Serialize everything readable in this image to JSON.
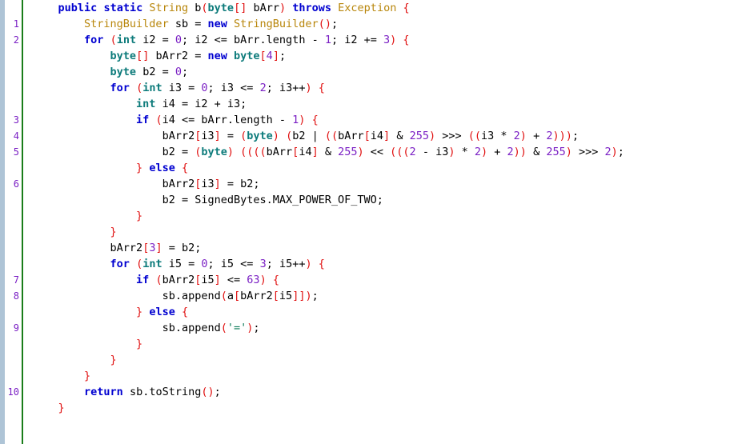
{
  "editor": {
    "name": "code-viewer",
    "language": "java",
    "background_color": "#ffffff",
    "edge_strip_color": "#aec4d6",
    "separator_color": "#1a7d1a",
    "line_number_color": "#7a1fc4",
    "colors": {
      "keyword": "#0000d0",
      "primitive_type": "#0d7b7b",
      "class_type": "#b8860b",
      "number": "#7a1fc4",
      "punctuation": "#e01010",
      "string": "#0d7b5a",
      "plain": "#000000"
    }
  },
  "gutter": {
    "line_numbers": [
      "",
      "1",
      "2",
      "",
      "",
      "",
      "",
      "3",
      "4",
      "5",
      "",
      "6",
      "",
      "",
      "",
      "",
      "",
      "7",
      "8",
      "",
      "9",
      "",
      "",
      "",
      "10",
      ""
    ]
  },
  "code": {
    "plain_text": [
      "    public static String b(byte[] bArr) throws Exception {",
      "        StringBuilder sb = new StringBuilder();",
      "        for (int i2 = 0; i2 <= bArr.length - 1; i2 += 3) {",
      "            byte[] bArr2 = new byte[4];",
      "            byte b2 = 0;",
      "            for (int i3 = 0; i3 <= 2; i3++) {",
      "                int i4 = i2 + i3;",
      "                if (i4 <= bArr.length - 1) {",
      "                    bArr2[i3] = (byte) (b2 | ((bArr[i4] & 255) >>> ((i3 * 2) + 2)));",
      "                    b2 = (byte) ((((bArr[i4] & 255) << (((2 - i3) * 2) + 2)) & 255) >>> 2);",
      "                } else {",
      "                    bArr2[i3] = b2;",
      "                    b2 = SignedBytes.MAX_POWER_OF_TWO;",
      "                }",
      "            }",
      "            bArr2[3] = b2;",
      "            for (int i5 = 0; i5 <= 3; i5++) {",
      "                if (bArr2[i5] <= 63) {",
      "                    sb.append(a[bArr2[i5]]);",
      "                } else {",
      "                    sb.append('=');",
      "                }",
      "            }",
      "        }",
      "        return sb.toString();",
      "    }"
    ],
    "lines": [
      [
        {
          "t": "    ",
          "c": "plain"
        },
        {
          "t": "public",
          "c": "kw"
        },
        {
          "t": " ",
          "c": "plain"
        },
        {
          "t": "static",
          "c": "kw"
        },
        {
          "t": " ",
          "c": "plain"
        },
        {
          "t": "String",
          "c": "cls"
        },
        {
          "t": " b",
          "c": "plain"
        },
        {
          "t": "(",
          "c": "punct"
        },
        {
          "t": "byte",
          "c": "type"
        },
        {
          "t": "[]",
          "c": "punct"
        },
        {
          "t": " bArr",
          "c": "plain"
        },
        {
          "t": ")",
          "c": "punct"
        },
        {
          "t": " ",
          "c": "plain"
        },
        {
          "t": "throws",
          "c": "kw"
        },
        {
          "t": " ",
          "c": "plain"
        },
        {
          "t": "Exception",
          "c": "cls"
        },
        {
          "t": " ",
          "c": "plain"
        },
        {
          "t": "{",
          "c": "punct"
        }
      ],
      [
        {
          "t": "        ",
          "c": "plain"
        },
        {
          "t": "StringBuilder",
          "c": "cls"
        },
        {
          "t": " sb = ",
          "c": "plain"
        },
        {
          "t": "new",
          "c": "kw"
        },
        {
          "t": " ",
          "c": "plain"
        },
        {
          "t": "StringBuilder",
          "c": "cls"
        },
        {
          "t": "()",
          "c": "punct"
        },
        {
          "t": ";",
          "c": "plain"
        }
      ],
      [
        {
          "t": "        ",
          "c": "plain"
        },
        {
          "t": "for",
          "c": "kw"
        },
        {
          "t": " ",
          "c": "plain"
        },
        {
          "t": "(",
          "c": "punct"
        },
        {
          "t": "int",
          "c": "type"
        },
        {
          "t": " i2 = ",
          "c": "plain"
        },
        {
          "t": "0",
          "c": "num"
        },
        {
          "t": "; i2 <= bArr.length - ",
          "c": "plain"
        },
        {
          "t": "1",
          "c": "num"
        },
        {
          "t": "; i2 += ",
          "c": "plain"
        },
        {
          "t": "3",
          "c": "num"
        },
        {
          "t": ")",
          "c": "punct"
        },
        {
          "t": " ",
          "c": "plain"
        },
        {
          "t": "{",
          "c": "punct"
        }
      ],
      [
        {
          "t": "            ",
          "c": "plain"
        },
        {
          "t": "byte",
          "c": "type"
        },
        {
          "t": "[]",
          "c": "punct"
        },
        {
          "t": " bArr2 = ",
          "c": "plain"
        },
        {
          "t": "new",
          "c": "kw"
        },
        {
          "t": " ",
          "c": "plain"
        },
        {
          "t": "byte",
          "c": "type"
        },
        {
          "t": "[",
          "c": "punct"
        },
        {
          "t": "4",
          "c": "num"
        },
        {
          "t": "]",
          "c": "punct"
        },
        {
          "t": ";",
          "c": "plain"
        }
      ],
      [
        {
          "t": "            ",
          "c": "plain"
        },
        {
          "t": "byte",
          "c": "type"
        },
        {
          "t": " b2 = ",
          "c": "plain"
        },
        {
          "t": "0",
          "c": "num"
        },
        {
          "t": ";",
          "c": "plain"
        }
      ],
      [
        {
          "t": "            ",
          "c": "plain"
        },
        {
          "t": "for",
          "c": "kw"
        },
        {
          "t": " ",
          "c": "plain"
        },
        {
          "t": "(",
          "c": "punct"
        },
        {
          "t": "int",
          "c": "type"
        },
        {
          "t": " i3 = ",
          "c": "plain"
        },
        {
          "t": "0",
          "c": "num"
        },
        {
          "t": "; i3 <= ",
          "c": "plain"
        },
        {
          "t": "2",
          "c": "num"
        },
        {
          "t": "; i3++",
          "c": "plain"
        },
        {
          "t": ")",
          "c": "punct"
        },
        {
          "t": " ",
          "c": "plain"
        },
        {
          "t": "{",
          "c": "punct"
        }
      ],
      [
        {
          "t": "                ",
          "c": "plain"
        },
        {
          "t": "int",
          "c": "type"
        },
        {
          "t": " i4 = i2 + i3;",
          "c": "plain"
        }
      ],
      [
        {
          "t": "                ",
          "c": "plain"
        },
        {
          "t": "if",
          "c": "kw"
        },
        {
          "t": " ",
          "c": "plain"
        },
        {
          "t": "(",
          "c": "punct"
        },
        {
          "t": "i4 <= bArr.length - ",
          "c": "plain"
        },
        {
          "t": "1",
          "c": "num"
        },
        {
          "t": ")",
          "c": "punct"
        },
        {
          "t": " ",
          "c": "plain"
        },
        {
          "t": "{",
          "c": "punct"
        }
      ],
      [
        {
          "t": "                    ",
          "c": "plain"
        },
        {
          "t": "bArr2",
          "c": "plain"
        },
        {
          "t": "[",
          "c": "punct"
        },
        {
          "t": "i3",
          "c": "plain"
        },
        {
          "t": "]",
          "c": "punct"
        },
        {
          "t": " = ",
          "c": "plain"
        },
        {
          "t": "(",
          "c": "punct"
        },
        {
          "t": "byte",
          "c": "type"
        },
        {
          "t": ")",
          "c": "punct"
        },
        {
          "t": " ",
          "c": "plain"
        },
        {
          "t": "(",
          "c": "punct"
        },
        {
          "t": "b2 | ",
          "c": "plain"
        },
        {
          "t": "((",
          "c": "punct"
        },
        {
          "t": "bArr",
          "c": "plain"
        },
        {
          "t": "[",
          "c": "punct"
        },
        {
          "t": "i4",
          "c": "plain"
        },
        {
          "t": "]",
          "c": "punct"
        },
        {
          "t": " & ",
          "c": "plain"
        },
        {
          "t": "255",
          "c": "num"
        },
        {
          "t": ")",
          "c": "punct"
        },
        {
          "t": " >>> ",
          "c": "plain"
        },
        {
          "t": "((",
          "c": "punct"
        },
        {
          "t": "i3 * ",
          "c": "plain"
        },
        {
          "t": "2",
          "c": "num"
        },
        {
          "t": ")",
          "c": "punct"
        },
        {
          "t": " + ",
          "c": "plain"
        },
        {
          "t": "2",
          "c": "num"
        },
        {
          "t": ")))",
          "c": "punct"
        },
        {
          "t": ";",
          "c": "plain"
        }
      ],
      [
        {
          "t": "                    ",
          "c": "plain"
        },
        {
          "t": "b2 = ",
          "c": "plain"
        },
        {
          "t": "(",
          "c": "punct"
        },
        {
          "t": "byte",
          "c": "type"
        },
        {
          "t": ")",
          "c": "punct"
        },
        {
          "t": " ",
          "c": "plain"
        },
        {
          "t": "((((",
          "c": "punct"
        },
        {
          "t": "bArr",
          "c": "plain"
        },
        {
          "t": "[",
          "c": "punct"
        },
        {
          "t": "i4",
          "c": "plain"
        },
        {
          "t": "]",
          "c": "punct"
        },
        {
          "t": " & ",
          "c": "plain"
        },
        {
          "t": "255",
          "c": "num"
        },
        {
          "t": ")",
          "c": "punct"
        },
        {
          "t": " << ",
          "c": "plain"
        },
        {
          "t": "(((",
          "c": "punct"
        },
        {
          "t": "2",
          "c": "num"
        },
        {
          "t": " - i3",
          "c": "plain"
        },
        {
          "t": ")",
          "c": "punct"
        },
        {
          "t": " * ",
          "c": "plain"
        },
        {
          "t": "2",
          "c": "num"
        },
        {
          "t": ")",
          "c": "punct"
        },
        {
          "t": " + ",
          "c": "plain"
        },
        {
          "t": "2",
          "c": "num"
        },
        {
          "t": "))",
          "c": "punct"
        },
        {
          "t": " & ",
          "c": "plain"
        },
        {
          "t": "255",
          "c": "num"
        },
        {
          "t": ")",
          "c": "punct"
        },
        {
          "t": " >>> ",
          "c": "plain"
        },
        {
          "t": "2",
          "c": "num"
        },
        {
          "t": ")",
          "c": "punct"
        },
        {
          "t": ";",
          "c": "plain"
        }
      ],
      [
        {
          "t": "                ",
          "c": "plain"
        },
        {
          "t": "}",
          "c": "punct"
        },
        {
          "t": " ",
          "c": "plain"
        },
        {
          "t": "else",
          "c": "kw"
        },
        {
          "t": " ",
          "c": "plain"
        },
        {
          "t": "{",
          "c": "punct"
        }
      ],
      [
        {
          "t": "                    ",
          "c": "plain"
        },
        {
          "t": "bArr2",
          "c": "plain"
        },
        {
          "t": "[",
          "c": "punct"
        },
        {
          "t": "i3",
          "c": "plain"
        },
        {
          "t": "]",
          "c": "punct"
        },
        {
          "t": " = b2;",
          "c": "plain"
        }
      ],
      [
        {
          "t": "                    ",
          "c": "plain"
        },
        {
          "t": "b2 = SignedBytes.MAX_POWER_OF_TWO;",
          "c": "plain"
        }
      ],
      [
        {
          "t": "                ",
          "c": "plain"
        },
        {
          "t": "}",
          "c": "punct"
        }
      ],
      [
        {
          "t": "            ",
          "c": "plain"
        },
        {
          "t": "}",
          "c": "punct"
        }
      ],
      [
        {
          "t": "            ",
          "c": "plain"
        },
        {
          "t": "bArr2",
          "c": "plain"
        },
        {
          "t": "[",
          "c": "punct"
        },
        {
          "t": "3",
          "c": "num"
        },
        {
          "t": "]",
          "c": "punct"
        },
        {
          "t": " = b2;",
          "c": "plain"
        }
      ],
      [
        {
          "t": "            ",
          "c": "plain"
        },
        {
          "t": "for",
          "c": "kw"
        },
        {
          "t": " ",
          "c": "plain"
        },
        {
          "t": "(",
          "c": "punct"
        },
        {
          "t": "int",
          "c": "type"
        },
        {
          "t": " i5 = ",
          "c": "plain"
        },
        {
          "t": "0",
          "c": "num"
        },
        {
          "t": "; i5 <= ",
          "c": "plain"
        },
        {
          "t": "3",
          "c": "num"
        },
        {
          "t": "; i5++",
          "c": "plain"
        },
        {
          "t": ")",
          "c": "punct"
        },
        {
          "t": " ",
          "c": "plain"
        },
        {
          "t": "{",
          "c": "punct"
        }
      ],
      [
        {
          "t": "                ",
          "c": "plain"
        },
        {
          "t": "if",
          "c": "kw"
        },
        {
          "t": " ",
          "c": "plain"
        },
        {
          "t": "(",
          "c": "punct"
        },
        {
          "t": "bArr2",
          "c": "plain"
        },
        {
          "t": "[",
          "c": "punct"
        },
        {
          "t": "i5",
          "c": "plain"
        },
        {
          "t": "]",
          "c": "punct"
        },
        {
          "t": " <= ",
          "c": "plain"
        },
        {
          "t": "63",
          "c": "num"
        },
        {
          "t": ")",
          "c": "punct"
        },
        {
          "t": " ",
          "c": "plain"
        },
        {
          "t": "{",
          "c": "punct"
        }
      ],
      [
        {
          "t": "                    ",
          "c": "plain"
        },
        {
          "t": "sb.append",
          "c": "plain"
        },
        {
          "t": "(",
          "c": "punct"
        },
        {
          "t": "a",
          "c": "plain"
        },
        {
          "t": "[",
          "c": "punct"
        },
        {
          "t": "bArr2",
          "c": "plain"
        },
        {
          "t": "[",
          "c": "punct"
        },
        {
          "t": "i5",
          "c": "plain"
        },
        {
          "t": "]]",
          "c": "punct"
        },
        {
          "t": ")",
          "c": "punct"
        },
        {
          "t": ";",
          "c": "plain"
        }
      ],
      [
        {
          "t": "                ",
          "c": "plain"
        },
        {
          "t": "}",
          "c": "punct"
        },
        {
          "t": " ",
          "c": "plain"
        },
        {
          "t": "else",
          "c": "kw"
        },
        {
          "t": " ",
          "c": "plain"
        },
        {
          "t": "{",
          "c": "punct"
        }
      ],
      [
        {
          "t": "                    ",
          "c": "plain"
        },
        {
          "t": "sb.append",
          "c": "plain"
        },
        {
          "t": "(",
          "c": "punct"
        },
        {
          "t": "'='",
          "c": "str"
        },
        {
          "t": ")",
          "c": "punct"
        },
        {
          "t": ";",
          "c": "plain"
        }
      ],
      [
        {
          "t": "                ",
          "c": "plain"
        },
        {
          "t": "}",
          "c": "punct"
        }
      ],
      [
        {
          "t": "            ",
          "c": "plain"
        },
        {
          "t": "}",
          "c": "punct"
        }
      ],
      [
        {
          "t": "        ",
          "c": "plain"
        },
        {
          "t": "}",
          "c": "punct"
        }
      ],
      [
        {
          "t": "        ",
          "c": "plain"
        },
        {
          "t": "return",
          "c": "kw"
        },
        {
          "t": " sb.toString",
          "c": "plain"
        },
        {
          "t": "()",
          "c": "punct"
        },
        {
          "t": ";",
          "c": "plain"
        }
      ],
      [
        {
          "t": "    ",
          "c": "plain"
        },
        {
          "t": "}",
          "c": "punct"
        }
      ]
    ]
  }
}
